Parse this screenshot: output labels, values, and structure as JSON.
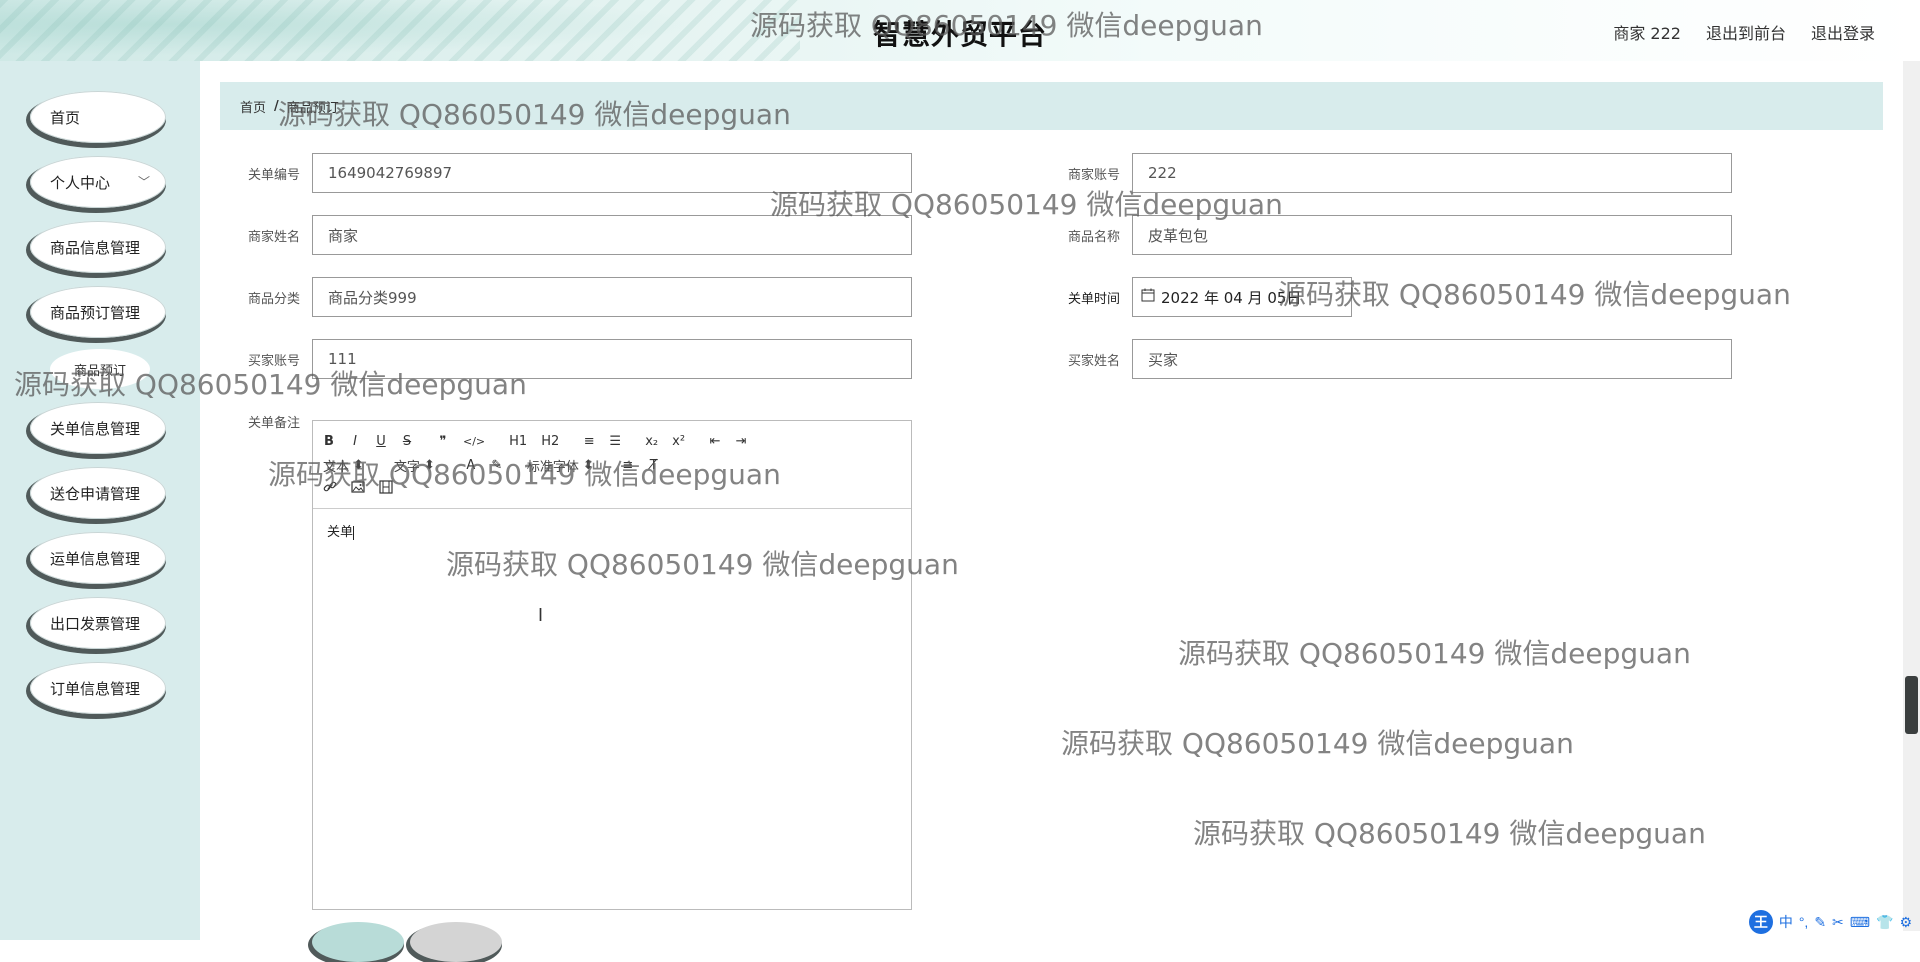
{
  "header": {
    "title": "智慧外贸平台",
    "user": "商家 222",
    "back_front": "退出到前台",
    "logout": "退出登录"
  },
  "sidebar": {
    "items": [
      {
        "label": "首页"
      },
      {
        "label": "个人中心",
        "has_chevron": true
      },
      {
        "label": "商品信息管理"
      },
      {
        "label": "商品预订管理"
      },
      {
        "label": "关单信息管理"
      },
      {
        "label": "送仓申请管理"
      },
      {
        "label": "运单信息管理"
      },
      {
        "label": "出口发票管理"
      },
      {
        "label": "订单信息管理"
      }
    ],
    "submenu": "商品预订"
  },
  "breadcrumb": {
    "home": "首页",
    "current": "商品预订"
  },
  "form": {
    "customs_no": {
      "label": "关单编号",
      "value": "1649042769897"
    },
    "merchant_account": {
      "label": "商家账号",
      "value": "222"
    },
    "merchant_name": {
      "label": "商家姓名",
      "value": "商家"
    },
    "product_name": {
      "label": "商品名称",
      "value": "皮革包包"
    },
    "product_category": {
      "label": "商品分类",
      "value": "商品分类999"
    },
    "customs_time": {
      "label": "关单时间",
      "value": "2022 年 04 月 05日"
    },
    "buyer_account": {
      "label": "买家账号",
      "value": "111"
    },
    "buyer_name": {
      "label": "买家姓名",
      "value": "买家"
    },
    "remarks": {
      "label": "关单备注",
      "value": "关单"
    }
  },
  "editor": {
    "toolbar_row1": [
      "B",
      "I",
      "U",
      "S",
      "❞",
      "</>",
      "H1",
      "H2",
      "≡",
      "☰",
      "x₂",
      "x²",
      "⇤",
      "⇥"
    ],
    "toolbar_row2": {
      "size_select": "文本",
      "font_select": "文字",
      "font_family_select": "标准字体"
    }
  },
  "watermark": "源码获取 QQ86050149 微信deepguan",
  "ime": {
    "logo": "王",
    "lang": "中"
  }
}
